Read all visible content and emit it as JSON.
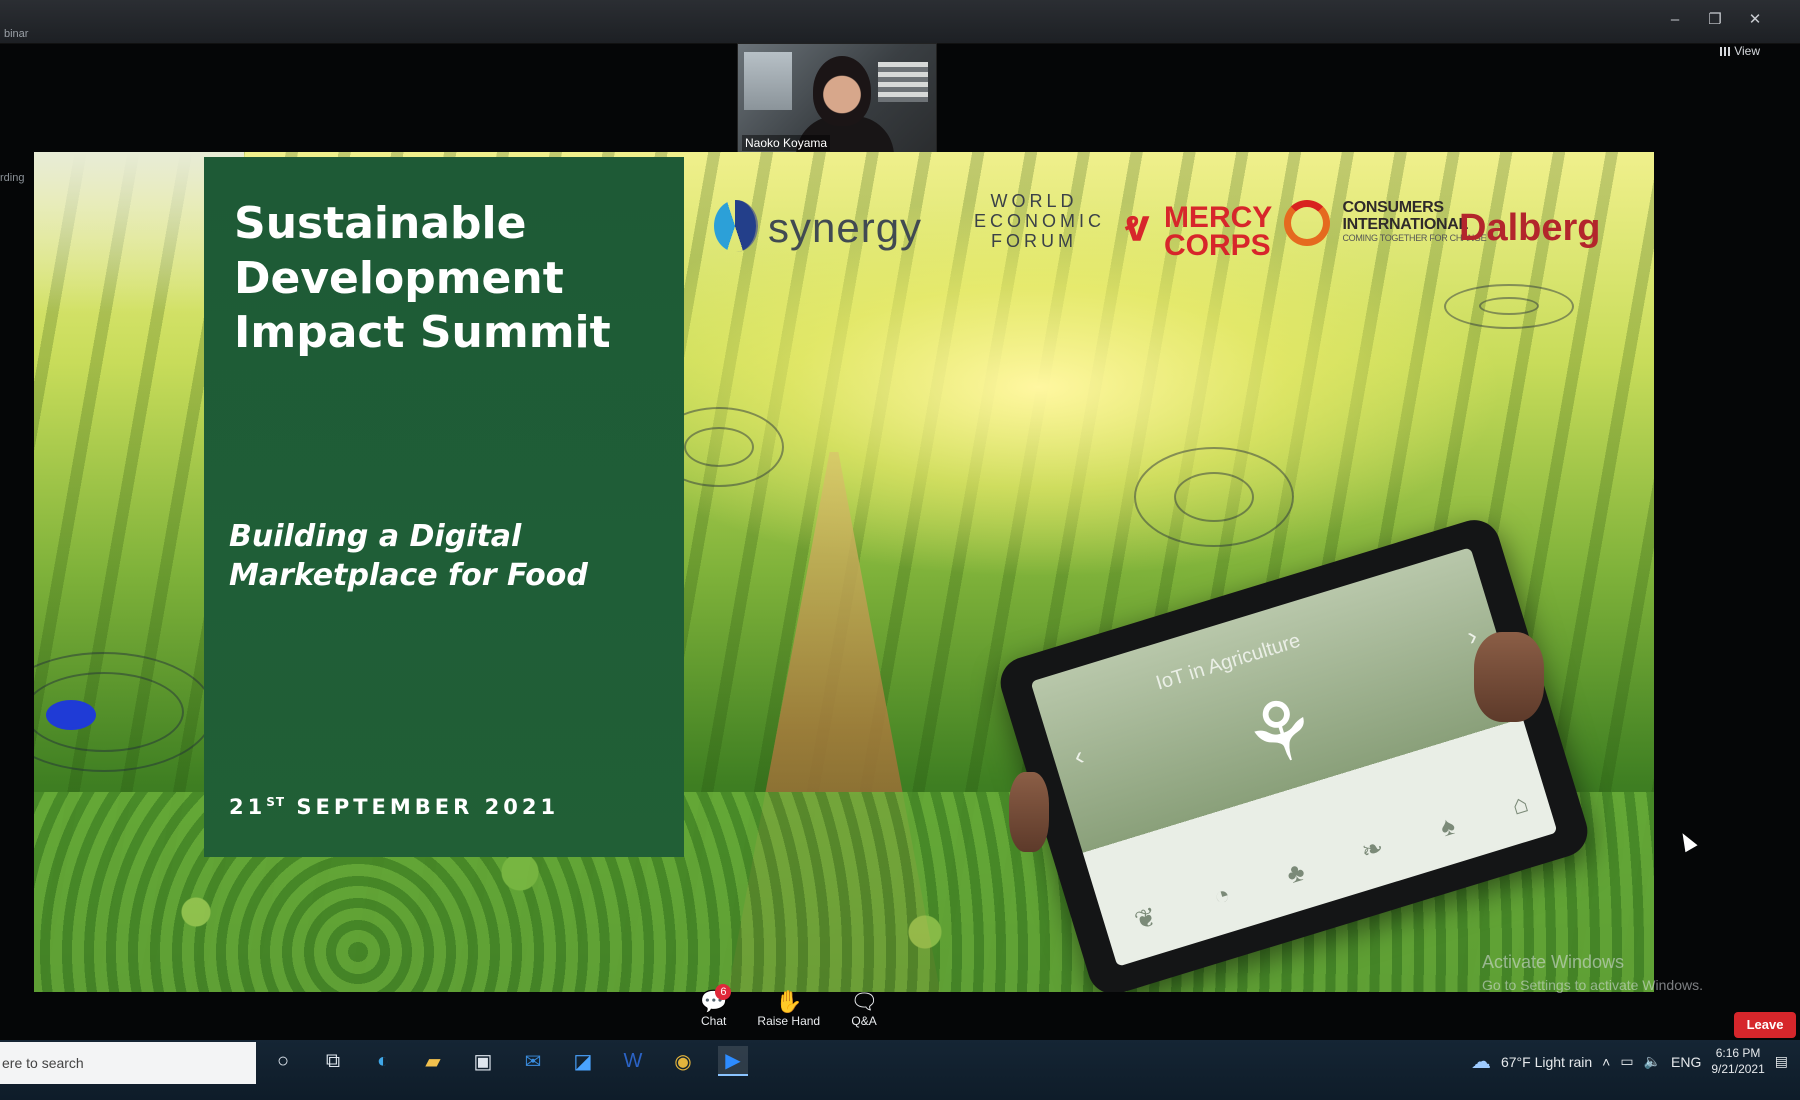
{
  "window": {
    "title": "binar",
    "controls": {
      "minimize": "–",
      "restore": "❐",
      "close": "✕"
    },
    "view_label": "View",
    "side_label": "rding"
  },
  "participant": {
    "name": "Naoko Koyama"
  },
  "slide": {
    "title_lines": [
      "Sustainable",
      "Development",
      "Impact Summit"
    ],
    "subtitle_lines": [
      "Building a Digital",
      "Marketplace for Food"
    ],
    "date_day": "21",
    "date_suffix": "ST",
    "date_rest": "SEPTEMBER 2021",
    "logos": {
      "synergy": "synergy",
      "wef_lines": [
        "WORLD",
        "ECONOMIC",
        "FORUM"
      ],
      "mercy_lines": [
        "MERCY",
        "CORPS"
      ],
      "ci_lines": [
        "CONSUMERS",
        "INTERNATIONAL"
      ],
      "ci_tagline": "COMING TOGETHER FOR CHANGE",
      "dalberg": "Dalberg"
    },
    "tablet": {
      "heading": "IoT in Agriculture"
    }
  },
  "watermark": {
    "line1": "Activate Windows",
    "line2": "Go to Settings to activate Windows."
  },
  "controls": {
    "chat_label": "Chat",
    "chat_badge": "6",
    "raise_hand_label": "Raise Hand",
    "qa_label": "Q&A",
    "leave_label": "Leave"
  },
  "taskbar": {
    "search_placeholder": "ere to search",
    "weather": "67°F  Light rain",
    "language": "ENG",
    "time": "6:16 PM",
    "date": "9/21/2021"
  },
  "colors": {
    "panel_green": "#1f5e37",
    "leave_red": "#d6262b",
    "dalberg_red": "#b3262c",
    "mercy_red": "#d7262b"
  }
}
